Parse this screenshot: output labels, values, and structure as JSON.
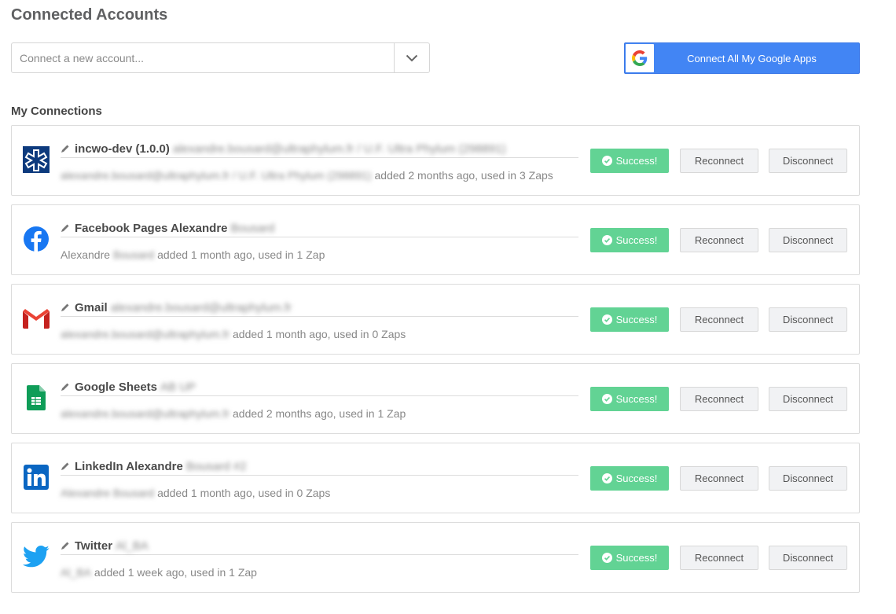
{
  "page_title": "Connected Accounts",
  "connect_select": {
    "placeholder": "Connect a new account...",
    "arrow_icon": "chevron-down-icon"
  },
  "google_button": {
    "label": "Connect All My Google Apps",
    "icon": "google-g-icon",
    "color": "#4285f4"
  },
  "section_title": "My Connections",
  "status_color": "#62d394",
  "connections": [
    {
      "icon": "incwo-icon",
      "title": "incwo-dev (1.0.0)",
      "title_blurred": "alexandre.bousard@ultraphylum.fr / U.F. Ultra Phylum (298891)",
      "meta_blurred": "alexandre.bousard@ultraphylum.fr / U.F. Ultra Phylum (298891)",
      "meta": "added 2 months ago, used in 3 Zaps",
      "status": "Success!",
      "reconnect": "Reconnect",
      "disconnect": "Disconnect"
    },
    {
      "icon": "facebook-icon",
      "title": "Facebook Pages Alexandre",
      "title_blurred": "Bousard",
      "meta_prefix": "Alexandre",
      "meta_blurred": "Bousard",
      "meta": "added 1 month ago, used in 1 Zap",
      "status": "Success!",
      "reconnect": "Reconnect",
      "disconnect": "Disconnect"
    },
    {
      "icon": "gmail-icon",
      "title": "Gmail",
      "title_blurred": "alexandre.bousard@ultraphylum.fr",
      "meta_blurred": "alexandre.bousard@ultraphylum.fr",
      "meta": "added 1 month ago, used in 0 Zaps",
      "status": "Success!",
      "reconnect": "Reconnect",
      "disconnect": "Disconnect"
    },
    {
      "icon": "google-sheets-icon",
      "title": "Google Sheets",
      "title_blurred": "AB UP",
      "meta_blurred": "alexandre.bousard@ultraphylum.fr",
      "meta": "added 2 months ago, used in 1 Zap",
      "status": "Success!",
      "reconnect": "Reconnect",
      "disconnect": "Disconnect"
    },
    {
      "icon": "linkedin-icon",
      "title": "LinkedIn Alexandre",
      "title_blurred": "Bousard #2",
      "meta_blurred": "Alexandre Bousard",
      "meta": "added 1 month ago, used in 0 Zaps",
      "status": "Success!",
      "reconnect": "Reconnect",
      "disconnect": "Disconnect"
    },
    {
      "icon": "twitter-icon",
      "title": "Twitter",
      "title_blurred": "Al_BA",
      "meta_blurred": "Al_BA",
      "meta": "added 1 week ago, used in 1 Zap",
      "status": "Success!",
      "reconnect": "Reconnect",
      "disconnect": "Disconnect"
    }
  ]
}
